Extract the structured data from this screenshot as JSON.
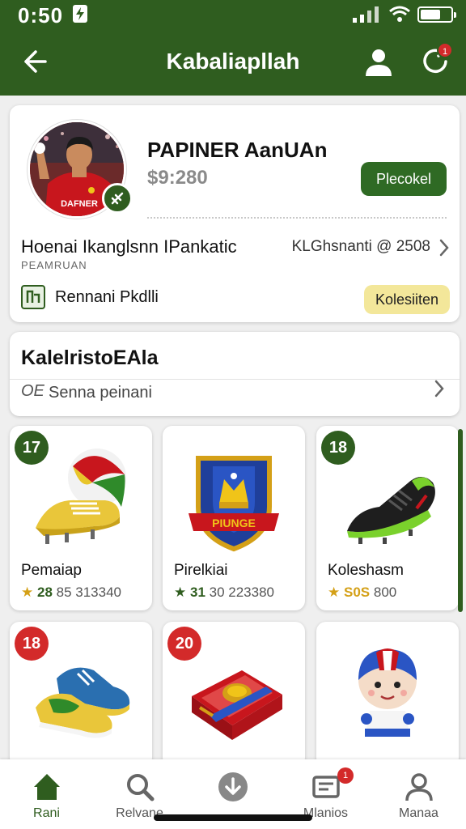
{
  "status_bar": {
    "time": "0:50"
  },
  "header": {
    "title": "Kabaliapllah"
  },
  "notifications": {
    "count": "1"
  },
  "profile": {
    "name": "PAPINER AanUAn",
    "price": "$9:280",
    "proceed_label": "Plecokel",
    "info_left": "Hoenai Ikanglsnn IPankatic",
    "info_right": "KLGhsnanti @ 2508",
    "info_sub": "PEAMRUAN",
    "product_label": "Rennani Pkdlli",
    "collect_label": "Kolesiiten",
    "jersey_text": "DAFNER"
  },
  "section": {
    "title": "KalelristoEAla",
    "search_icon": "OE",
    "search_text": "Senna peinani"
  },
  "items": [
    {
      "badge": "17",
      "name": "Pemaiap",
      "rating": "28",
      "extra": "85 313340",
      "icon": "soccer-boot-ball-icon"
    },
    {
      "badge": "",
      "name": "Pirelkiai",
      "rating": "31",
      "extra": "30 223380",
      "icon": "shield-crest-icon",
      "art_text": "PIUNGE"
    },
    {
      "badge": "18",
      "name": "Koleshasm",
      "rating": "S0S",
      "extra": "800",
      "icon": "football-boot-icon"
    },
    {
      "badge": "18",
      "name": "",
      "icon": "sneakers-icon"
    },
    {
      "badge": "20",
      "name": "",
      "icon": "treasure-book-icon"
    },
    {
      "badge": "",
      "name": "",
      "icon": "mascot-figure-icon"
    }
  ],
  "nav": {
    "items": [
      {
        "label": "Rani",
        "icon": "home-icon"
      },
      {
        "label": "Relvane",
        "icon": "search-icon"
      },
      {
        "label": "",
        "icon": "download-icon"
      },
      {
        "label": "Mlanios",
        "icon": "messages-icon",
        "badge": "1"
      },
      {
        "label": "Manaa",
        "icon": "profile-icon"
      }
    ]
  },
  "colors": {
    "primary": "#2f5d1f",
    "accent_red": "#d32a2a",
    "collect_yellow": "#f3e79a",
    "star": "#d4a017"
  }
}
